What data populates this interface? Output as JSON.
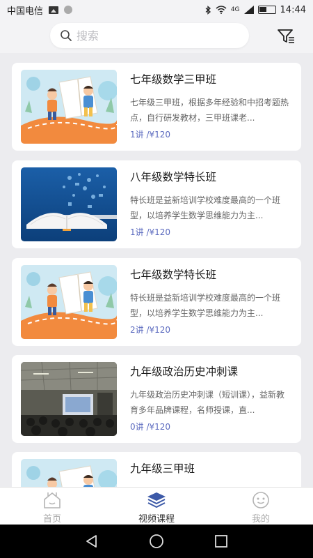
{
  "status_bar": {
    "carrier": "中国电信",
    "network": "4G",
    "time": "14:44"
  },
  "search": {
    "placeholder": "搜索",
    "value": ""
  },
  "icons": {
    "search": "search-icon",
    "filter": "filter-icon",
    "home": "home-icon",
    "courses": "layers-icon",
    "mine": "smiley-icon"
  },
  "colors": {
    "accent": "#5b6abf",
    "tab_active_icon": "#3d5aa8",
    "background": "#ececef"
  },
  "courses": [
    {
      "title": "七年级数学三甲班",
      "description": "七年级三甲班，根据多年经验和中招考题热点，自行研发教材，三甲班课老...",
      "meta": "1讲 /¥120",
      "thumbnail": "kids-on-book-illustration"
    },
    {
      "title": "八年级数学特长班",
      "description": "特长班是益新培训学校难度最高的一个班型，以培养学生数学思维能力为主...",
      "meta": "1讲 /¥120",
      "thumbnail": "open-book-laptop-illustration"
    },
    {
      "title": "七年级数学特长班",
      "description": "特长班是益新培训学校难度最高的一个班型，以培养学生数学思维能力为主...",
      "meta": "2讲 /¥120",
      "thumbnail": "kids-on-book-illustration"
    },
    {
      "title": "九年级政治历史冲刺课",
      "description": "九年级政治历史冲刺课（短训课），益新教育多年品牌课程，名师授课，直...",
      "meta": "0讲 /¥120",
      "thumbnail": "classroom-photo"
    },
    {
      "title": "九年级三甲班",
      "description": "",
      "meta": "",
      "thumbnail": "kids-on-book-illustration"
    }
  ],
  "tabs": [
    {
      "label": "首页",
      "active": false
    },
    {
      "label": "视频课程",
      "active": true
    },
    {
      "label": "我的",
      "active": false
    }
  ]
}
